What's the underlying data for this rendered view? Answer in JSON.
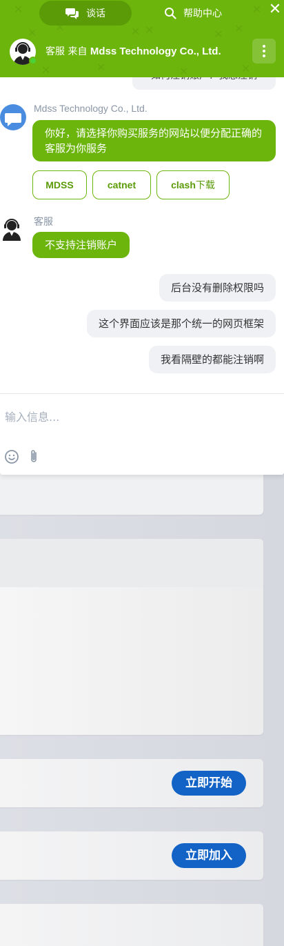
{
  "header": {
    "tabs": [
      {
        "label": "谈话",
        "icon": "chat-bubbles-icon",
        "active": true
      },
      {
        "label": "帮助中心",
        "icon": "search-icon",
        "active": false
      }
    ],
    "agent_prefix": "客服 来自",
    "agent_company": "Mdss Technology Co., Ltd.",
    "accent_color": "#6cb50c"
  },
  "messages": {
    "previous_cut_text": "如何注销账户？我想注销",
    "bot_sender": "Mdss Technology Co., Ltd.",
    "bot_message": "你好，请选择你购买服务的网站以便分配正确的客服为你服务",
    "choices": [
      {
        "label": "MDSS",
        "suffix": ""
      },
      {
        "label": "catnet",
        "suffix": ""
      },
      {
        "label": "clash",
        "suffix": "下载"
      }
    ],
    "agent_sender": "客服",
    "agent_message": "不支持注销账户",
    "user_messages": [
      "后台没有删除权限吗",
      "这个界面应该是那个统一的网页框架",
      "我看隔壁的都能注销啊"
    ]
  },
  "composer": {
    "placeholder": "输入信息...",
    "icons": [
      "emoji-icon",
      "paperclip-icon"
    ]
  },
  "background": {
    "buttons": [
      "立即开始",
      "立即加入"
    ],
    "button_color": "#1363c6"
  }
}
